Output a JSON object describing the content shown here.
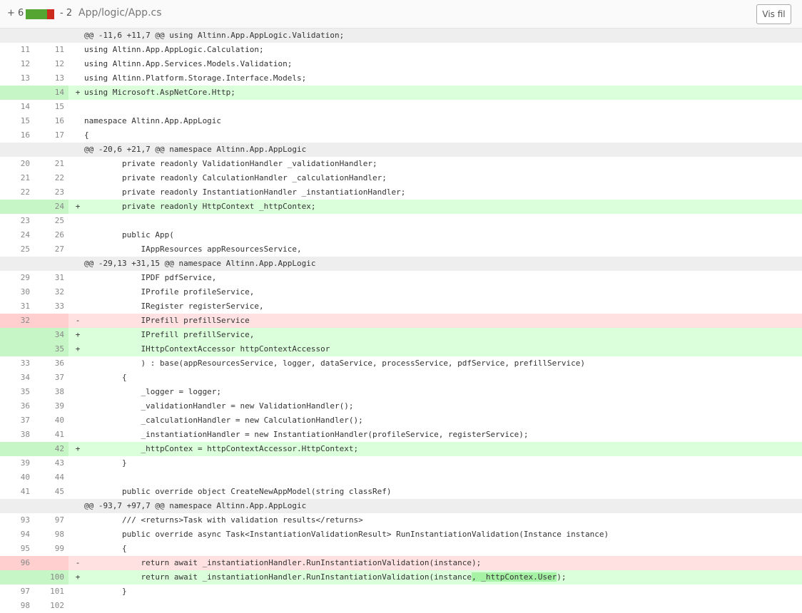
{
  "header": {
    "additions": "+ 6",
    "deletions": "- 2",
    "file_path": "App/logic/App.cs",
    "view_button": "Vis fil",
    "colors": {
      "add_bar": "#55a532",
      "del_bar": "#cb2a1d"
    }
  },
  "diff": {
    "colors": {
      "added_bg": "#dbffdb",
      "removed_bg": "#ffe1e1",
      "hunk_bg": "#eeeeee",
      "highlight": "#a6f3a6"
    },
    "lines": [
      {
        "type": "hunk",
        "old": "",
        "new": "",
        "sign": "",
        "code": "@@ -11,6 +11,7 @@ using Altinn.App.AppLogic.Validation;"
      },
      {
        "type": "ctx",
        "old": "11",
        "new": "11",
        "sign": "",
        "code": "using Altinn.App.AppLogic.Calculation;"
      },
      {
        "type": "ctx",
        "old": "12",
        "new": "12",
        "sign": "",
        "code": "using Altinn.App.Services.Models.Validation;"
      },
      {
        "type": "ctx",
        "old": "13",
        "new": "13",
        "sign": "",
        "code": "using Altinn.Platform.Storage.Interface.Models;"
      },
      {
        "type": "add",
        "old": "",
        "new": "14",
        "sign": "+",
        "code": "using Microsoft.AspNetCore.Http;"
      },
      {
        "type": "ctx",
        "old": "14",
        "new": "15",
        "sign": "",
        "code": ""
      },
      {
        "type": "ctx",
        "old": "15",
        "new": "16",
        "sign": "",
        "code": "namespace Altinn.App.AppLogic"
      },
      {
        "type": "ctx",
        "old": "16",
        "new": "17",
        "sign": "",
        "code": "{"
      },
      {
        "type": "hunk",
        "old": "",
        "new": "",
        "sign": "",
        "code": "@@ -20,6 +21,7 @@ namespace Altinn.App.AppLogic"
      },
      {
        "type": "ctx",
        "old": "20",
        "new": "21",
        "sign": "",
        "code": "        private readonly ValidationHandler _validationHandler;"
      },
      {
        "type": "ctx",
        "old": "21",
        "new": "22",
        "sign": "",
        "code": "        private readonly CalculationHandler _calculationHandler;"
      },
      {
        "type": "ctx",
        "old": "22",
        "new": "23",
        "sign": "",
        "code": "        private readonly InstantiationHandler _instantiationHandler;"
      },
      {
        "type": "add",
        "old": "",
        "new": "24",
        "sign": "+",
        "code": "        private readonly HttpContext _httpContex;"
      },
      {
        "type": "ctx",
        "old": "23",
        "new": "25",
        "sign": "",
        "code": ""
      },
      {
        "type": "ctx",
        "old": "24",
        "new": "26",
        "sign": "",
        "code": "        public App("
      },
      {
        "type": "ctx",
        "old": "25",
        "new": "27",
        "sign": "",
        "code": "            IAppResources appResourcesService,"
      },
      {
        "type": "hunk",
        "old": "",
        "new": "",
        "sign": "",
        "code": "@@ -29,13 +31,15 @@ namespace Altinn.App.AppLogic"
      },
      {
        "type": "ctx",
        "old": "29",
        "new": "31",
        "sign": "",
        "code": "            IPDF pdfService,"
      },
      {
        "type": "ctx",
        "old": "30",
        "new": "32",
        "sign": "",
        "code": "            IProfile profileService,"
      },
      {
        "type": "ctx",
        "old": "31",
        "new": "33",
        "sign": "",
        "code": "            IRegister registerService,"
      },
      {
        "type": "del",
        "old": "32",
        "new": "",
        "sign": "-",
        "code": "            IPrefill prefillService"
      },
      {
        "type": "add",
        "old": "",
        "new": "34",
        "sign": "+",
        "code": "            IPrefill prefillService,"
      },
      {
        "type": "add",
        "old": "",
        "new": "35",
        "sign": "+",
        "code": "            IHttpContextAccessor httpContextAccessor"
      },
      {
        "type": "ctx",
        "old": "33",
        "new": "36",
        "sign": "",
        "code": "            ) : base(appResourcesService, logger, dataService, processService, pdfService, prefillService)"
      },
      {
        "type": "ctx",
        "old": "34",
        "new": "37",
        "sign": "",
        "code": "        {"
      },
      {
        "type": "ctx",
        "old": "35",
        "new": "38",
        "sign": "",
        "code": "            _logger = logger;"
      },
      {
        "type": "ctx",
        "old": "36",
        "new": "39",
        "sign": "",
        "code": "            _validationHandler = new ValidationHandler();"
      },
      {
        "type": "ctx",
        "old": "37",
        "new": "40",
        "sign": "",
        "code": "            _calculationHandler = new CalculationHandler();"
      },
      {
        "type": "ctx",
        "old": "38",
        "new": "41",
        "sign": "",
        "code": "            _instantiationHandler = new InstantiationHandler(profileService, registerService);"
      },
      {
        "type": "add",
        "old": "",
        "new": "42",
        "sign": "+",
        "code": "            _httpContex = httpContextAccessor.HttpContext;"
      },
      {
        "type": "ctx",
        "old": "39",
        "new": "43",
        "sign": "",
        "code": "        }"
      },
      {
        "type": "ctx",
        "old": "40",
        "new": "44",
        "sign": "",
        "code": ""
      },
      {
        "type": "ctx",
        "old": "41",
        "new": "45",
        "sign": "",
        "code": "        public override object CreateNewAppModel(string classRef)"
      },
      {
        "type": "hunk",
        "old": "",
        "new": "",
        "sign": "",
        "code": "@@ -93,7 +97,7 @@ namespace Altinn.App.AppLogic"
      },
      {
        "type": "ctx",
        "old": "93",
        "new": "97",
        "sign": "",
        "code": "        /// <returns>Task with validation results</returns>"
      },
      {
        "type": "ctx",
        "old": "94",
        "new": "98",
        "sign": "",
        "code": "        public override async Task<InstantiationValidationResult> RunInstantiationValidation(Instance instance)"
      },
      {
        "type": "ctx",
        "old": "95",
        "new": "99",
        "sign": "",
        "code": "        {"
      },
      {
        "type": "del",
        "old": "96",
        "new": "",
        "sign": "-",
        "code": "            return await _instantiationHandler.RunInstantiationValidation(instance);"
      },
      {
        "type": "add",
        "old": "",
        "new": "100",
        "sign": "+",
        "code_pre": "            return await _instantiationHandler.RunInstantiationValidation(instance",
        "code_hl": ", _httpContex.User",
        "code_post": ");"
      },
      {
        "type": "ctx",
        "old": "97",
        "new": "101",
        "sign": "",
        "code": "        }"
      },
      {
        "type": "ctx",
        "old": "98",
        "new": "102",
        "sign": "",
        "code": ""
      }
    ]
  }
}
